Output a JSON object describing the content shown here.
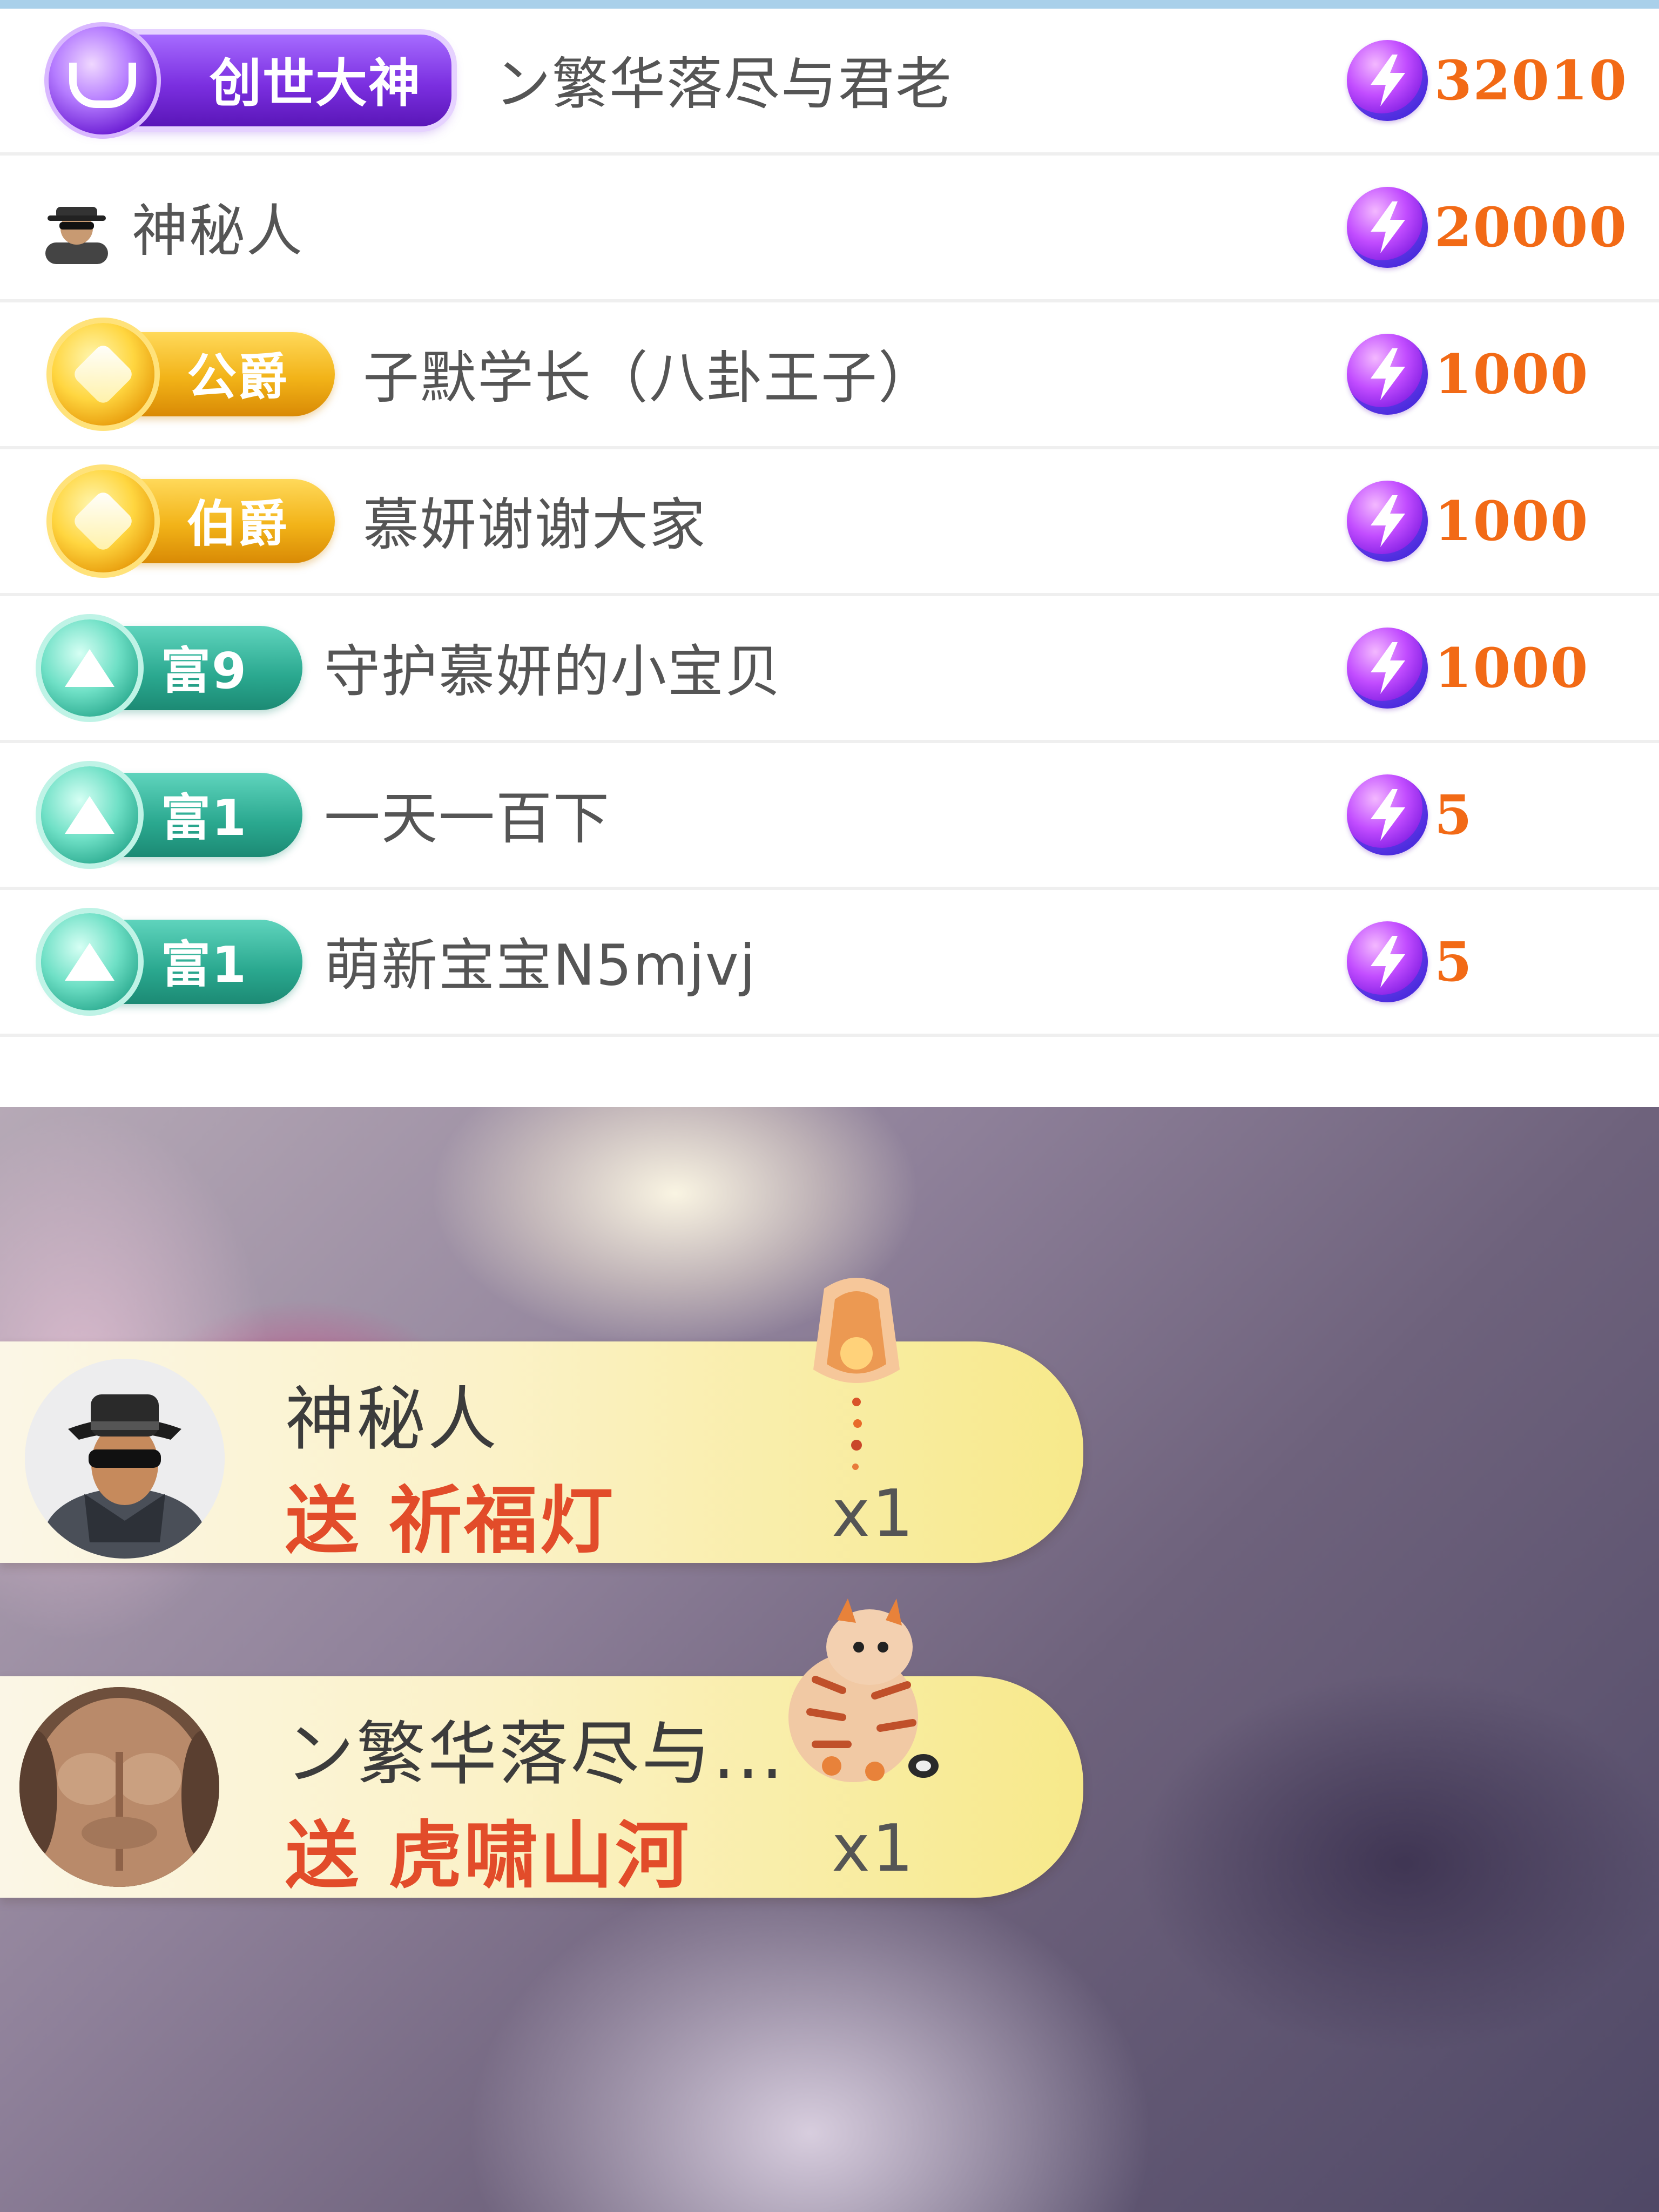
{
  "ranking_list": {
    "items": [
      {
        "badge": "创世大神",
        "badge_color": "#7b2fe0",
        "name": "ン繁华落尽与君老",
        "amount": "32010",
        "amount_icon": "lightning-coin-icon"
      },
      {
        "badge": "",
        "avatar_icon": "mystery-person-icon",
        "name": "神秘人",
        "amount": "20000",
        "amount_icon": "lightning-coin-icon"
      },
      {
        "badge": "公爵",
        "badge_color": "#f2b318",
        "name": "子默学长（八卦王子）",
        "amount": "1000",
        "amount_icon": "lightning-coin-icon"
      },
      {
        "badge": "伯爵",
        "badge_color": "#f2b318",
        "name": "慕妍谢谢大家",
        "amount": "1000",
        "amount_icon": "lightning-coin-icon"
      },
      {
        "badge": "富9",
        "badge_color": "#2aa88f",
        "name": "守护慕妍的小宝贝",
        "amount": "1000",
        "amount_icon": "lightning-coin-icon"
      },
      {
        "badge": "富1",
        "badge_color": "#2aa88f",
        "name": "一天一百下",
        "amount": "5",
        "amount_icon": "lightning-coin-icon"
      },
      {
        "badge": "富1",
        "badge_color": "#2aa88f",
        "name": "萌新宝宝N5mjvj",
        "amount": "5",
        "amount_icon": "lightning-coin-icon"
      }
    ]
  },
  "gift_notifications": [
    {
      "sender": "神秘人",
      "send_label": "送",
      "gift_name": "祈福灯",
      "count": "x1",
      "avatar_icon": "mystery-person-icon",
      "gift_icon": "prayer-lantern-icon"
    },
    {
      "sender": "ン繁华落尽与...",
      "send_label": "送",
      "gift_name": "虎啸山河",
      "count": "x1",
      "avatar_icon": "user-avatar-icon",
      "gift_icon": "tiger-gift-icon"
    }
  ],
  "colors": {
    "amount": "#f26a16",
    "gift_text": "#e24c2a",
    "gift_card": "#f7e98a",
    "top_strip": "#a9d0ea"
  }
}
